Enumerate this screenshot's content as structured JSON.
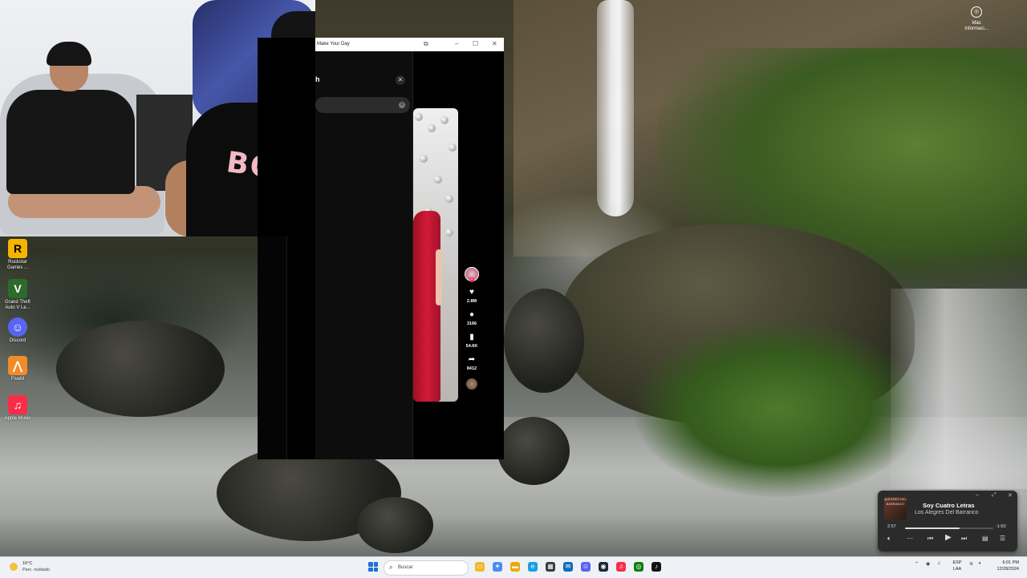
{
  "desktop": {
    "icons": [
      {
        "label": "Rockstar Games ...",
        "glyph": "R",
        "color": "#f4b400",
        "fg": "#000"
      },
      {
        "label": "Grand Theft Auto V Le...",
        "glyph": "V",
        "color": "#2d6b2d",
        "fg": "#fff"
      },
      {
        "label": "Discord",
        "glyph": "☺",
        "color": "#5865f2",
        "fg": "#fff"
      },
      {
        "label": "FiveM",
        "glyph": "⋀",
        "color": "#f28c28",
        "fg": "#fff"
      },
      {
        "label": "Apple Music",
        "glyph": "♫",
        "color": "#fa2d48",
        "fg": "#fff"
      }
    ],
    "info_widget": {
      "label": "Más informaci..."
    }
  },
  "webcam": {
    "shirt_text": "BOSS"
  },
  "app_window": {
    "title": "Make Your Day",
    "controls": {
      "share": "⧉",
      "minimize": "–",
      "maximize": "☐",
      "close": "✕"
    },
    "panel_heading": "h",
    "panel_close": "✕",
    "search_clear": "✕",
    "video": {
      "likes": "2.8M",
      "comments": "3166",
      "saves": "54.6K",
      "shares": "8412"
    }
  },
  "media_player": {
    "song": "Soy Cuatro Letras",
    "artist": "Los Alegres Del Barranco",
    "album_art_text": "ALEGRES DEL BARRANCO",
    "elapsed": "2:57",
    "remaining": "-1:50",
    "progress": 0.62
  },
  "taskbar": {
    "weather": {
      "temp": "16°C",
      "condition": "Parc. nublado"
    },
    "search_placeholder": "Buscar",
    "apps": [
      {
        "name": "file-explorer",
        "glyph": "▭",
        "color": "#f2b825"
      },
      {
        "name": "copilot",
        "glyph": "✦",
        "color": "#4a8df0"
      },
      {
        "name": "folder",
        "glyph": "▬",
        "color": "#f0a800"
      },
      {
        "name": "edge",
        "glyph": "e",
        "color": "#1b9de2"
      },
      {
        "name": "calculator",
        "glyph": "▦",
        "color": "#3a3a3a"
      },
      {
        "name": "mail",
        "glyph": "✉",
        "color": "#0f6cbd"
      },
      {
        "name": "discord",
        "glyph": "☺",
        "color": "#5865f2"
      },
      {
        "name": "steam",
        "glyph": "◉",
        "color": "#1b2838"
      },
      {
        "name": "apple-music",
        "glyph": "♫",
        "color": "#fa2d48"
      },
      {
        "name": "xbox",
        "glyph": "◎",
        "color": "#107c10"
      },
      {
        "name": "tiktok",
        "glyph": "♪",
        "color": "#111111"
      }
    ],
    "language": {
      "line1": "ESP",
      "line2": "LAA"
    },
    "time": "6:01 PM",
    "date": "12/28/2024"
  }
}
